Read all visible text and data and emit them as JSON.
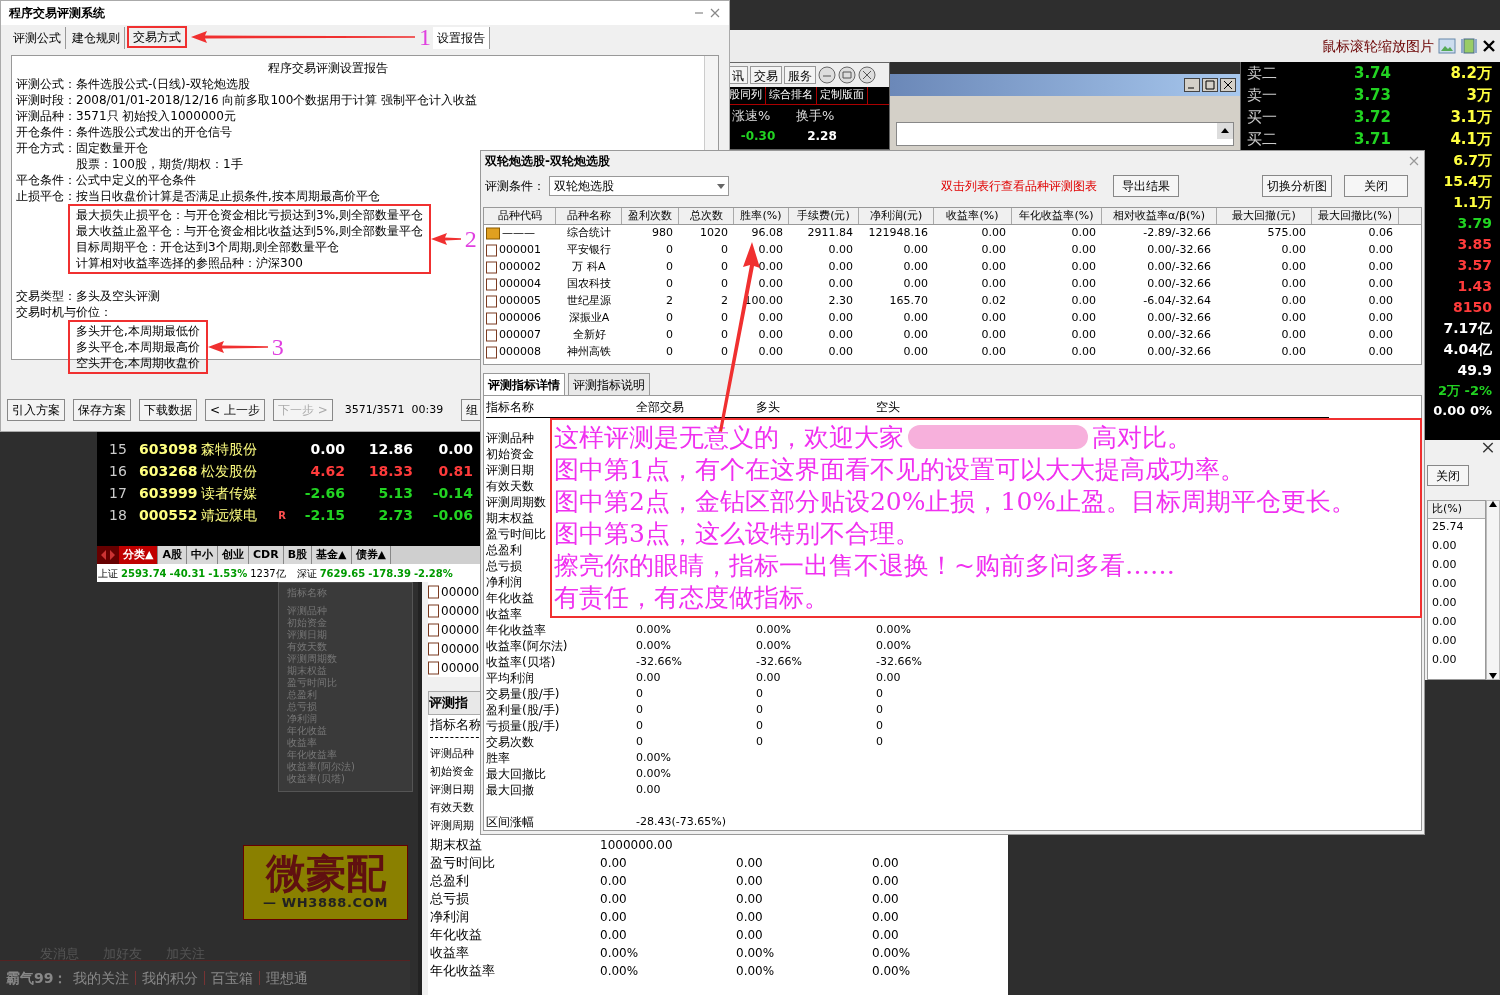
{
  "toolbar": {
    "hint": "鼠标滚轮缩放图片"
  },
  "main_window": {
    "title": "程序交易评测系统",
    "tabs": [
      {
        "label": "评测公式",
        "selected": false
      },
      {
        "label": "建仓规则",
        "selected": false
      },
      {
        "label": "交易方式",
        "selected": false,
        "callout": "1"
      },
      {
        "label": "设置报告",
        "selected": true
      }
    ],
    "report": {
      "heading": "程序交易评测设置报告",
      "groups": [
        {
          "lines": [
            {
              "label": "评测公式：",
              "value": "条件选股公式-(日线)-双轮炮选股"
            },
            {
              "label": "评测时段：",
              "value": "2008/01/01-2018/12/16 向前多取100个数据用于计算 强制平仓计入收益"
            },
            {
              "label": "评测品种：",
              "value": "3571只 初始投入1000000元"
            },
            {
              "label": "开仓条件：",
              "value": "条件选股公式发出的开仓信号"
            },
            {
              "label": "开仓方式：",
              "value": "固定数量开仓"
            },
            {
              "value": "股票：100股，期货/期权：1手"
            },
            {
              "label": "平仓条件：",
              "value": "公式中定义的平仓条件"
            },
            {
              "label": "止损平仓：",
              "value": "按当日收盘价计算是否满足止损条件,按本周期最高价平仓"
            }
          ]
        },
        {
          "callout": "2",
          "lines": [
            {
              "value": "最大损失止损平仓：与开仓资金相比亏损达到3%,则全部数量平仓"
            },
            {
              "value": "最大收益止盈平仓：与开仓资金相比收益达到5%,则全部数量平仓"
            },
            {
              "value": "目标周期平仓：开仓达到3个周期,则全部数量平仓"
            },
            {
              "value": "计算相对收益率选择的参照品种：沪深300"
            }
          ]
        },
        {
          "lines": [
            {
              "label": "交易类型：",
              "value": "多头及空头评测"
            },
            {
              "label": "交易时机与价位："
            }
          ]
        },
        {
          "callout": "3",
          "lines": [
            {
              "value": "多头开仓,本周期最低价"
            },
            {
              "value": "多头平仓,本周期最高价"
            },
            {
              "value": "空头开仓,本周期收盘价"
            }
          ]
        }
      ]
    },
    "buttons": [
      {
        "label": "引入方案",
        "disabled": false
      },
      {
        "label": "保存方案",
        "disabled": false
      },
      {
        "label": "下载数据",
        "disabled": false
      },
      {
        "label": "< 上一步",
        "disabled": false
      },
      {
        "label": "下一步 >",
        "disabled": true
      }
    ],
    "progress": "3571/3571  00:39",
    "cut_button": "组"
  },
  "quote_window": {
    "buttons": [
      "讯",
      "交易",
      "服务"
    ],
    "tabs": [
      "股同列",
      "综合排名",
      "定制版面"
    ],
    "columns": [
      "涨速%",
      "换手%"
    ],
    "values": [
      {
        "text": "-0.30",
        "color": "#22d322"
      },
      {
        "text": "2.28",
        "color": "#ffffff"
      }
    ]
  },
  "order_book": {
    "rows": [
      {
        "label": "卖二",
        "price": "3.74",
        "volume": "8.2万"
      },
      {
        "label": "卖一",
        "price": "3.73",
        "volume": "3万"
      },
      {
        "label": "买一",
        "price": "3.72",
        "volume": "3.1万"
      },
      {
        "label": "买二",
        "price": "3.71",
        "volume": "4.1万"
      }
    ],
    "side_values": [
      {
        "text": "6.7万",
        "color": "#ffff40"
      },
      {
        "text": "15.4万",
        "color": "#ffff40"
      },
      {
        "text": "1.1万",
        "color": "#ffff40"
      },
      {
        "text": "3.79",
        "color": "#22d322"
      },
      {
        "text": "3.85",
        "color": "#ff3b3b"
      },
      {
        "text": "3.57",
        "color": "#ff3b3b"
      },
      {
        "text": "1.43",
        "color": "#ff3b3b"
      },
      {
        "text": "8150",
        "color": "#ff3b3b"
      },
      {
        "text": "7.17亿",
        "color": "#ffffff"
      },
      {
        "text": "4.04亿",
        "color": "#ffffff"
      },
      {
        "text": "49.9",
        "color": "#ffffff"
      }
    ],
    "footer": [
      {
        "text": "2万 -2%",
        "color": "#22d322"
      },
      {
        "text": "0.00 0%",
        "color": "#ffffff"
      }
    ]
  },
  "side_window": {
    "close_button": "关闭",
    "column": "比(%)",
    "values": [
      "25.74",
      "0.00",
      "0.00",
      "0.00",
      "0.00",
      "0.00",
      "0.00",
      "0.00"
    ]
  },
  "dialog": {
    "title": "双轮炮选股-双轮炮选股",
    "condition_label": "评测条件：",
    "condition_value": "双轮炮选股",
    "hint": "双击列表行查看品种评测图表",
    "buttons": [
      "导出结果",
      "切换分析图",
      "关闭"
    ],
    "columns": [
      "品种代码",
      "品种名称",
      "盈利次数",
      "总次数",
      "胜率(%)",
      "手续费(元)",
      "净利润(元)",
      "收益率(%)",
      "年化收益率(%)",
      "相对收益率α/β(%)",
      "最大回撤(元)",
      "最大回撤比(%)"
    ],
    "rows": [
      {
        "kind": "summary",
        "cells": [
          "———",
          "综合统计",
          "980",
          "1020",
          "96.08",
          "2911.84",
          "121948.16",
          "0.00",
          "0.00",
          "-2.89/-32.66",
          "575.00",
          "0.06"
        ]
      },
      {
        "kind": "stock",
        "cells": [
          "000001",
          "平安银行",
          "0",
          "0",
          "0.00",
          "0.00",
          "0.00",
          "0.00",
          "0.00",
          "0.00/-32.66",
          "0.00",
          "0.00"
        ]
      },
      {
        "kind": "stock",
        "cells": [
          "000002",
          "万 科A",
          "0",
          "0",
          "0.00",
          "0.00",
          "0.00",
          "0.00",
          "0.00",
          "0.00/-32.66",
          "0.00",
          "0.00"
        ]
      },
      {
        "kind": "stock",
        "cells": [
          "000004",
          "国农科技",
          "0",
          "0",
          "0.00",
          "0.00",
          "0.00",
          "0.00",
          "0.00",
          "0.00/-32.66",
          "0.00",
          "0.00"
        ]
      },
      {
        "kind": "stock",
        "cells": [
          "000005",
          "世纪星源",
          "2",
          "2",
          "100.00",
          "2.30",
          "165.70",
          "0.02",
          "0.00",
          "-6.04/-32.64",
          "0.00",
          "0.00"
        ]
      },
      {
        "kind": "stock",
        "cells": [
          "000006",
          "深振业A",
          "0",
          "0",
          "0.00",
          "0.00",
          "0.00",
          "0.00",
          "0.00",
          "0.00/-32.66",
          "0.00",
          "0.00"
        ]
      },
      {
        "kind": "stock",
        "cells": [
          "000007",
          "全新好",
          "0",
          "0",
          "0.00",
          "0.00",
          "0.00",
          "0.00",
          "0.00",
          "0.00/-32.66",
          "0.00",
          "0.00"
        ]
      },
      {
        "kind": "stock",
        "cells": [
          "000008",
          "神州高铁",
          "0",
          "0",
          "0.00",
          "0.00",
          "0.00",
          "0.00",
          "0.00",
          "0.00/-32.66",
          "0.00",
          "0.00"
        ]
      }
    ],
    "detail_tabs": [
      {
        "label": "评测指标详情",
        "selected": true
      },
      {
        "label": "评测指标说明",
        "selected": false
      }
    ],
    "detail_columns": [
      "指标名称",
      "全部交易",
      "多头",
      "空头"
    ],
    "detail_rows": [
      {
        "name": "评测品种",
        "values": []
      },
      {
        "name": "初始资金",
        "values": []
      },
      {
        "name": "评测日期",
        "values": []
      },
      {
        "name": "有效天数",
        "values": []
      },
      {
        "name": "评测周期数",
        "values": []
      },
      {
        "name": "期末权益",
        "values": []
      },
      {
        "name": "盈亏时间比",
        "values": []
      },
      {
        "name": "总盈利",
        "values": []
      },
      {
        "name": "总亏损",
        "values": []
      },
      {
        "name": "净利润",
        "values": []
      },
      {
        "name": "年化收益",
        "values": []
      },
      {
        "name": "收益率",
        "values": []
      },
      {
        "name": "年化收益率",
        "values": [
          "0.00%",
          "0.00%",
          "0.00%"
        ]
      },
      {
        "name": "收益率(阿尔法)",
        "values": [
          "0.00%",
          "0.00%",
          "0.00%"
        ]
      },
      {
        "name": "收益率(贝塔)",
        "values": [
          "-32.66%",
          "-32.66%",
          "-32.66%"
        ]
      },
      {
        "name": "平均利润",
        "values": [
          "0.00",
          "0.00",
          "0.00"
        ]
      },
      {
        "name": "交易量(股/手)",
        "values": [
          "0",
          "0",
          "0"
        ]
      },
      {
        "name": "盈利量(股/手)",
        "values": [
          "0",
          "0",
          "0"
        ]
      },
      {
        "name": "亏损量(股/手)",
        "values": [
          "0",
          "0",
          "0"
        ]
      },
      {
        "name": "交易次数",
        "values": [
          "0",
          "0",
          "0"
        ]
      },
      {
        "name": "胜率",
        "values": [
          "0.00%"
        ]
      },
      {
        "name": "最大回撤比",
        "values": [
          "0.00%"
        ]
      },
      {
        "name": "最大回撤",
        "values": [
          "0.00"
        ]
      }
    ],
    "range_row": {
      "name": "区间涨幅",
      "value": "-28.43(-73.65%)"
    }
  },
  "annotation": {
    "lines": [
      [
        "这样评测是无意义的，欢迎大家",
        "高对比。"
      ],
      [
        "图中第1点，有个在这界面看不见的设置可以大大提高成功率。"
      ],
      [
        "图中第2点，金钻区部分贴设20%止损，10%止盈。目标周期平仓更长。"
      ],
      [
        "图中第3点，这么设特别不合理。"
      ],
      [
        "擦亮你的眼睛，指标一出售不退换！~购前多问多看……"
      ],
      [
        "有责任，有态度做指标。"
      ]
    ]
  },
  "stock_list": {
    "rows": [
      {
        "no": "15",
        "code": "603098",
        "name": "森特股份",
        "change": "0.00",
        "price": "12.86",
        "rise": "0.00",
        "color": "#ffffff"
      },
      {
        "no": "16",
        "code": "603268",
        "name": "松发股份",
        "change": "4.62",
        "price": "18.33",
        "rise": "0.81",
        "color": "#ff3b3b"
      },
      {
        "no": "17",
        "code": "603999",
        "name": "读者传媒",
        "change": "-2.66",
        "price": "5.13",
        "rise": "-0.14",
        "color": "#22d322"
      },
      {
        "no": "18",
        "code": "000552",
        "name": "靖远煤电",
        "marker": "R",
        "change": "-2.15",
        "price": "2.73",
        "rise": "-0.06",
        "color": "#22d322"
      }
    ],
    "categories": [
      {
        "label": "分类▲",
        "selected": true
      },
      {
        "label": "A股",
        "selected": false
      },
      {
        "label": "中小",
        "selected": false
      },
      {
        "label": "创业",
        "selected": false
      },
      {
        "label": "CDR",
        "selected": false
      },
      {
        "label": "B股",
        "selected": false
      },
      {
        "label": "基金▲",
        "selected": false
      },
      {
        "label": "债券▲",
        "selected": false
      }
    ],
    "indices": [
      {
        "name": "上证",
        "value": "2593.74",
        "change": "-40.31",
        "percent": "-1.53%",
        "volume": "1237亿"
      },
      {
        "name": "深证",
        "value": "7629.65",
        "change": "-178.39",
        "percent": "-2.28%"
      }
    ]
  },
  "background_window": {
    "codes": [
      "00000",
      "00000",
      "00000",
      "00000",
      "00000"
    ],
    "tab": "评测指",
    "header": "指标名称",
    "labels": [
      "评测品种",
      "初始资金",
      "评测日期",
      "有效天数",
      "评测周期"
    ],
    "rows": [
      {
        "name": "期末权益",
        "values": [
          "1000000.00"
        ]
      },
      {
        "name": "盈亏时间比",
        "values": [
          "0.00",
          "0.00",
          "0.00"
        ]
      },
      {
        "name": "总盈利",
        "values": [
          "0.00",
          "0.00",
          "0.00"
        ]
      },
      {
        "name": "总亏损",
        "values": [
          "0.00",
          "0.00",
          "0.00"
        ]
      },
      {
        "name": "净利润",
        "values": [
          "0.00",
          "0.00",
          "0.00"
        ]
      },
      {
        "name": "年化收益",
        "values": [
          "0.00",
          "0.00",
          "0.00"
        ]
      },
      {
        "name": "收益率",
        "values": [
          "0.00%",
          "0.00%",
          "0.00%"
        ]
      },
      {
        "name": "年化收益率",
        "values": [
          "0.00%",
          "0.00%",
          "0.00%"
        ]
      }
    ]
  },
  "dim_panel": {
    "header": "指标名称",
    "labels": [
      "评测品种",
      "初始资金",
      "评测日期",
      "有效天数",
      "评测周期数",
      "期末权益",
      "盈亏时间比",
      "总盈利",
      "总亏损",
      "净利润",
      "年化收益",
      "收益率",
      "年化收益率",
      "收益率(阿尔法)",
      "收益率(贝塔)"
    ]
  },
  "ad_banner": {
    "title": "微豪配",
    "url": "— WH3888.COM"
  },
  "social": [
    "发消息",
    "加好友",
    "加关注"
  ],
  "footer": {
    "user": "霸气99：",
    "links": [
      "我的关注",
      "我的积分",
      "百宝箱",
      "理想通"
    ]
  }
}
